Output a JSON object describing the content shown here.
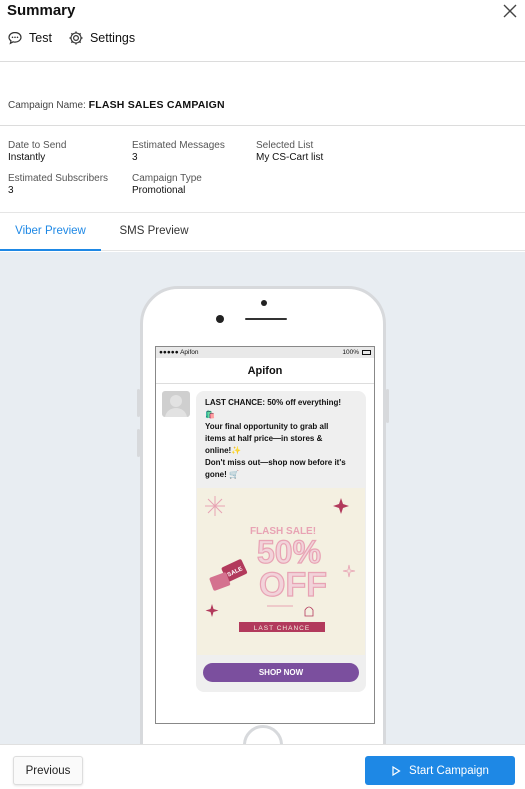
{
  "header": {
    "title": "Summary",
    "actions": [
      {
        "label": "Test",
        "icon": "chat-icon"
      },
      {
        "label": "Settings",
        "icon": "gear-icon"
      }
    ]
  },
  "campaign": {
    "name_label": "Campaign Name:",
    "name_value": "FLASH SALES CAMPAIGN"
  },
  "details": {
    "date_label": "Date to Send",
    "date_value": "Instantly",
    "messages_label": "Estimated Messages",
    "messages_value": "3",
    "list_label": "Selected List",
    "list_value": "My CS-Cart list",
    "subscribers_label": "Estimated Subscribers",
    "subscribers_value": "3",
    "type_label": "Campaign Type",
    "type_value": "Promotional"
  },
  "tabs": [
    {
      "label": "Viber Preview",
      "active": true
    },
    {
      "label": "SMS Preview",
      "active": false
    }
  ],
  "phone": {
    "carrier": "●●●●● Apifon",
    "battery": "100%",
    "app_title": "Apifon",
    "message_lines": [
      "LAST CHANCE: 50% off everything!",
      "🛍️",
      "Your final opportunity to grab all",
      "items at half price—in stores &",
      "online!✨",
      "Don't miss out—shop now before it's",
      "gone! 🛒"
    ],
    "banner": {
      "headline": "FLASH SALE!",
      "big_text_1": "50%",
      "big_text_2": "OFF",
      "tag_text": "SALE",
      "footer_text": "LAST CHANCE"
    },
    "cta_label": "SHOP NOW"
  },
  "footer": {
    "previous_label": "Previous",
    "start_label": "Start Campaign"
  },
  "colors": {
    "accent": "#1e88e5",
    "cta": "#7b4f9e",
    "banner_bg": "#f4f0e1",
    "banner_pink": "#e8a3b4",
    "banner_dark": "#b23a5c",
    "preview_bg": "#e8edf2"
  }
}
